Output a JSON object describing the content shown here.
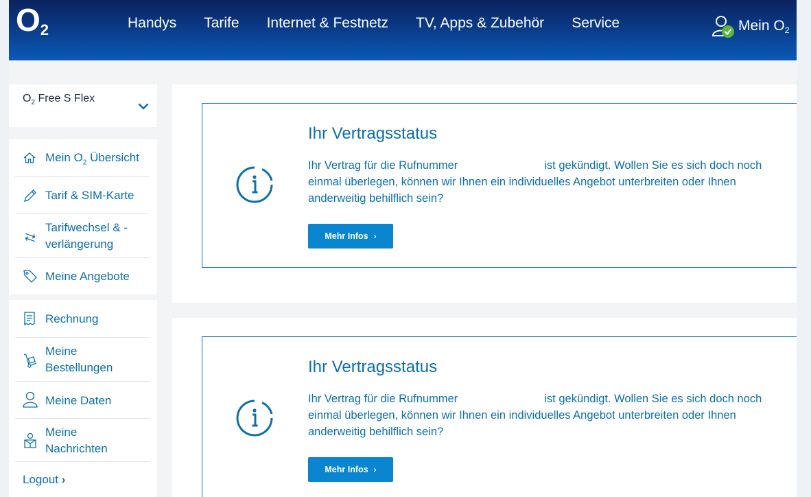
{
  "header": {
    "logo": "O",
    "logo_sub": "2",
    "nav": [
      "Handys",
      "Tarife",
      "Internet & Festnetz",
      "TV, Apps & Zubehör",
      "Service"
    ],
    "account_label": "Mein O",
    "account_sub": "2"
  },
  "sidebar": {
    "contract_label": "O",
    "contract_sub": "2",
    "contract_rest": " Free S Flex",
    "group1": [
      {
        "pre": "Mein O",
        "sub": "2",
        "post": " Übersicht",
        "icon": "home-icon"
      },
      {
        "label": "Tarif & SIM-Karte",
        "icon": "pencil-icon"
      },
      {
        "label": "Tarifwechsel & -verlängerung",
        "line1": "Tarifwechsel & -",
        "line2": "verlängerung",
        "icon": "swap-arrows-icon"
      },
      {
        "label": "Meine Angebote",
        "icon": "tag-icon"
      }
    ],
    "group2": [
      {
        "label": "Rechnung",
        "icon": "invoice-icon"
      },
      {
        "line1": "Meine",
        "line2": "Bestellungen",
        "icon": "hand-truck-icon"
      },
      {
        "label": "Meine Daten",
        "icon": "person-icon"
      },
      {
        "line1": "Meine",
        "line2": "Nachrichten",
        "icon": "mailbox-icon"
      }
    ],
    "logout": "Logout",
    "logout_chevron": "›"
  },
  "cards": [
    {
      "title": "Ihr Vertragsstatus",
      "text_pre": "Ihr Vertrag für die Rufnummer",
      "text_post": "ist gekündigt. Wollen Sie es sich doch noch einmal überlegen, können wir Ihnen ein individuelles Angebot unterbreiten oder Ihnen anderweitig behilflich sein?",
      "button": "Mehr Infos",
      "button_arrow": "›"
    },
    {
      "title": "Ihr Vertragsstatus",
      "text_pre": "Ihr Vertrag für die Rufnummer",
      "text_post": "ist gekündigt. Wollen Sie es sich doch noch einmal überlegen, können wir Ihnen ein individuelles Angebot unterbreiten oder Ihnen anderweitig behilflich sein?",
      "button": "Mehr Infos",
      "button_arrow": "›"
    }
  ],
  "colors": {
    "brand_dark": "#0b2360",
    "brand_blue": "#0a6fad",
    "button_blue": "#0a85d0",
    "status_green": "#5cb83a"
  }
}
